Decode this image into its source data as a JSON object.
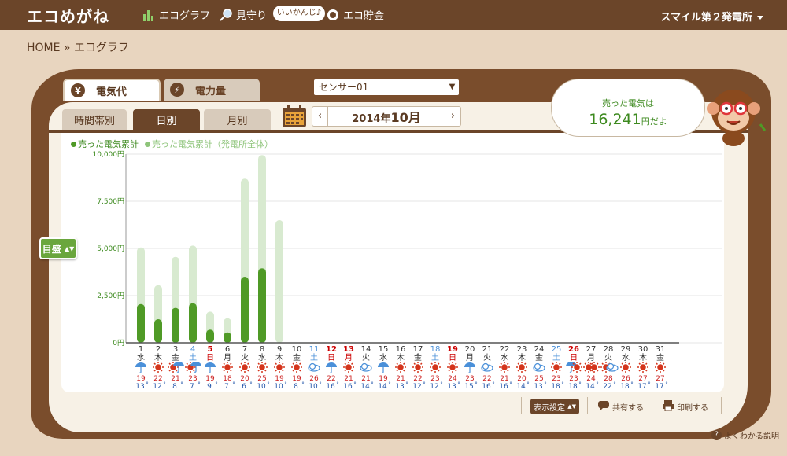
{
  "header": {
    "logo": "エコめがね",
    "nav": [
      {
        "label": "エコグラフ",
        "icon": "bar-chart-icon"
      },
      {
        "label": "見守り",
        "icon": "magnifier-icon"
      },
      {
        "label": "エコ貯金",
        "icon": "coin-icon"
      }
    ],
    "bubble": "いいかんじ♪",
    "plant": "スマイル第２発電所"
  },
  "breadcrumb": "HOME » エコグラフ",
  "tabs": {
    "main": [
      {
        "label": "電気代",
        "icon": "yen-icon",
        "active": true
      },
      {
        "label": "電力量",
        "icon": "bolt-icon",
        "active": false
      }
    ],
    "sub": [
      {
        "label": "時間帯別",
        "active": false
      },
      {
        "label": "日別",
        "active": true
      },
      {
        "label": "月別",
        "active": false
      }
    ]
  },
  "sensor": {
    "selected": "センサー01"
  },
  "month": {
    "year_label": "2014年",
    "month_label": "10月"
  },
  "speech": {
    "line1": "売った電気は",
    "amount": "16,241",
    "unit": "円だよ"
  },
  "yaxis_button": "目盛",
  "footer": {
    "display_settings": "表示設定",
    "share": "共有する",
    "print": "印刷する",
    "help": "よくわかる説明"
  },
  "colors": {
    "dark": "#4f9a26",
    "light": "#d8ead0",
    "brown": "#6b4529",
    "weekday": "#333333",
    "saturday": "#4a90d9",
    "holiday": "#cc0000"
  },
  "chart_data": {
    "type": "bar",
    "legend": [
      "売った電気累計",
      "売った電気累計（発電所全体）"
    ],
    "yticks": [
      "0円",
      "2,500円",
      "5,000円",
      "7,500円",
      "10,000円"
    ],
    "ylim": [
      0,
      10000
    ],
    "days": [
      "1",
      "2",
      "3",
      "4",
      "5",
      "6",
      "7",
      "8",
      "9",
      "10",
      "11",
      "12",
      "13",
      "14",
      "15",
      "16",
      "17",
      "18",
      "19",
      "20",
      "21",
      "22",
      "23",
      "24",
      "25",
      "26",
      "27",
      "28",
      "29",
      "30",
      "31"
    ],
    "weekdays": [
      "水",
      "木",
      "金",
      "土",
      "日",
      "月",
      "火",
      "水",
      "木",
      "金",
      "土",
      "日",
      "月",
      "火",
      "水",
      "木",
      "金",
      "土",
      "日",
      "月",
      "火",
      "水",
      "木",
      "金",
      "土",
      "日",
      "月",
      "火",
      "水",
      "木",
      "金"
    ],
    "day_types": [
      "w",
      "w",
      "w",
      "s",
      "h",
      "w",
      "w",
      "w",
      "w",
      "w",
      "s",
      "h",
      "h",
      "w",
      "w",
      "w",
      "w",
      "s",
      "h",
      "w",
      "w",
      "w",
      "w",
      "w",
      "s",
      "h",
      "w",
      "w",
      "w",
      "w",
      "w"
    ],
    "weather": [
      "rain",
      "sun",
      "sun-rain",
      "sun-rain",
      "rain",
      "sun",
      "sun",
      "sun",
      "sun",
      "sun",
      "cloud",
      "rain",
      "sun",
      "cloud",
      "rain",
      "sun",
      "sun",
      "sun",
      "sun",
      "rain",
      "cloud",
      "sun",
      "sun",
      "cloud",
      "sun",
      "rain-sun",
      "sun-sun",
      "sun-cloud",
      "sun",
      "sun",
      "sun"
    ],
    "high": [
      "19",
      "22",
      "21",
      "23",
      "19",
      "18",
      "20",
      "25",
      "19",
      "19",
      "26",
      "22",
      "21",
      "21",
      "19",
      "21",
      "22",
      "23",
      "24",
      "23",
      "22",
      "21",
      "20",
      "25",
      "23",
      "23",
      "24",
      "28",
      "26",
      "27",
      "27"
    ],
    "low": [
      "13",
      "12",
      "8",
      "7",
      "9",
      "7",
      "6",
      "10",
      "10",
      "8",
      "10",
      "16",
      "16",
      "14",
      "14",
      "13",
      "12",
      "12",
      "13",
      "15",
      "16",
      "16",
      "14",
      "13",
      "18",
      "18",
      "14",
      "22",
      "18",
      "17",
      "17"
    ],
    "series": [
      {
        "name": "売った電気累計",
        "values": [
          2050,
          1250,
          1850,
          2100,
          700,
          550,
          3500,
          3950,
          0
        ]
      },
      {
        "name": "売った電気累計（発電所全体）",
        "values": [
          5050,
          3050,
          4550,
          5150,
          1650,
          1300,
          8700,
          9950,
          6500
        ]
      }
    ]
  }
}
